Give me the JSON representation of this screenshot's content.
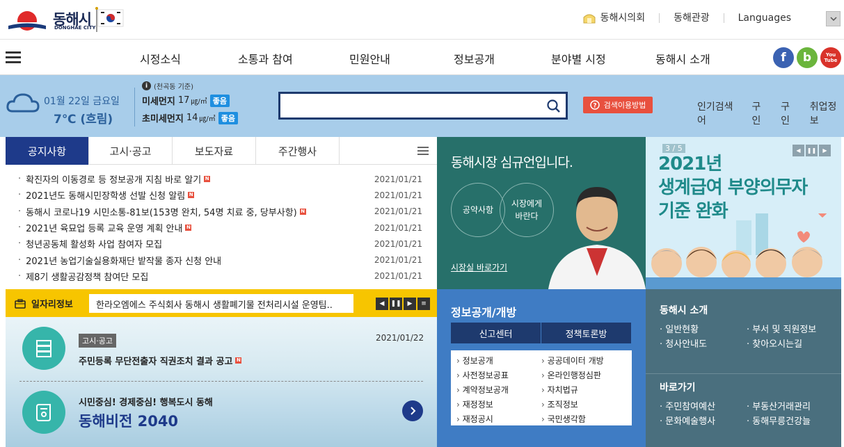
{
  "header": {
    "brand": "동해시",
    "brand_sub": "DONGHAE CITY",
    "links": [
      "동해시의회",
      "동해관광",
      "Languages"
    ]
  },
  "nav": {
    "items": [
      "시정소식",
      "소통과 참여",
      "민원안내",
      "정보공개",
      "분야별 시정",
      "동해시 소개"
    ],
    "sns": [
      "f",
      "b",
      "You Tube"
    ]
  },
  "weather": {
    "date": "01월 22일 금요일",
    "temp": "7℃ (흐림)"
  },
  "dust": {
    "base": "(천곡동 기준)",
    "pm10_label": "미세먼지",
    "pm10_value": "17",
    "pm25_label": "초미세먼지",
    "pm25_value": "14",
    "unit": "㎍/㎥",
    "status": "좋음"
  },
  "search": {
    "placeholder": "",
    "guide": "검색이용방법",
    "popular_label": "인기검색어",
    "popular": [
      "구인",
      "구인",
      "취업정보"
    ]
  },
  "notice": {
    "tabs": [
      "공지사항",
      "고시·공고",
      "보도자료",
      "주간행사"
    ],
    "items": [
      {
        "title": "확진자의 이동경로 등 정보공개 지침 바로 알기",
        "date": "2021/01/21",
        "new": "N"
      },
      {
        "title": "2021년도 동해시민장학생 선발 신청 알림",
        "date": "2021/01/21",
        "new": "N"
      },
      {
        "title": "동해시 코로나19 시민소통-81보(153명 완치, 54명 치료 중, 당부사항)",
        "date": "2021/01/21",
        "new": "N"
      },
      {
        "title": "2021년 육묘업 등록 교육 운영 계획 안내",
        "date": "2021/01/21",
        "new": "N"
      },
      {
        "title": "청년공동체 활성화 사업 참여자 모집",
        "date": "2021/01/21",
        "new": ""
      },
      {
        "title": "2021년 농업기술실용화재단 밭작물 종자 신청 안내",
        "date": "2021/01/21",
        "new": ""
      },
      {
        "title": "제8기 생활공감정책 참여단 모집",
        "date": "2021/01/21",
        "new": ""
      }
    ]
  },
  "job": {
    "label": "일자리정보",
    "text": "한라오엠에스 주식회사 동해시 생활폐기물 전처리시설 운영팀.."
  },
  "gosi": {
    "tag": "고시·공고",
    "date": "2021/01/22",
    "title": "주민등록 무단전출자 직권조치 결과 공고",
    "new": "N"
  },
  "vision": {
    "sub": "시민중심! 경제중심! 행복도시 동해",
    "title": "동해비전 2040"
  },
  "mayor": {
    "title": "동해시장 심규언입니다.",
    "btn1": "공약사항",
    "btn2a": "시장에게",
    "btn2b": "바란다",
    "link": "시장실 바로가기"
  },
  "welfare": {
    "count": "3 / 5",
    "line1": "2021년",
    "line2": "생계급여 부양의무자",
    "line3": "기준 완화"
  },
  "infoopen": {
    "title": "정보공개/개방",
    "tabs": [
      "신고센터",
      "정책토론방"
    ],
    "items": [
      "정보공개",
      "공공데이터 개방",
      "사전정보공표",
      "온라인행정심판",
      "계약정보공개",
      "자치법규",
      "재정정보",
      "조직정보",
      "재정공시",
      "국민생각함"
    ]
  },
  "intro": {
    "title1": "동해시 소개",
    "items1": [
      "일반현황",
      "부서 및 직원정보",
      "청사안내도",
      "찾아오시는길"
    ],
    "title2": "바로가기",
    "items2": [
      "주민참여예산",
      "부동산거래관리",
      "문화예술행사",
      "동해무릉건강늘"
    ]
  },
  "colors": {
    "primary": "#1e3a8a",
    "accent": "#e8503e",
    "job": "#f7c500",
    "teal": "#27706a",
    "info": "#3f7cc4"
  }
}
